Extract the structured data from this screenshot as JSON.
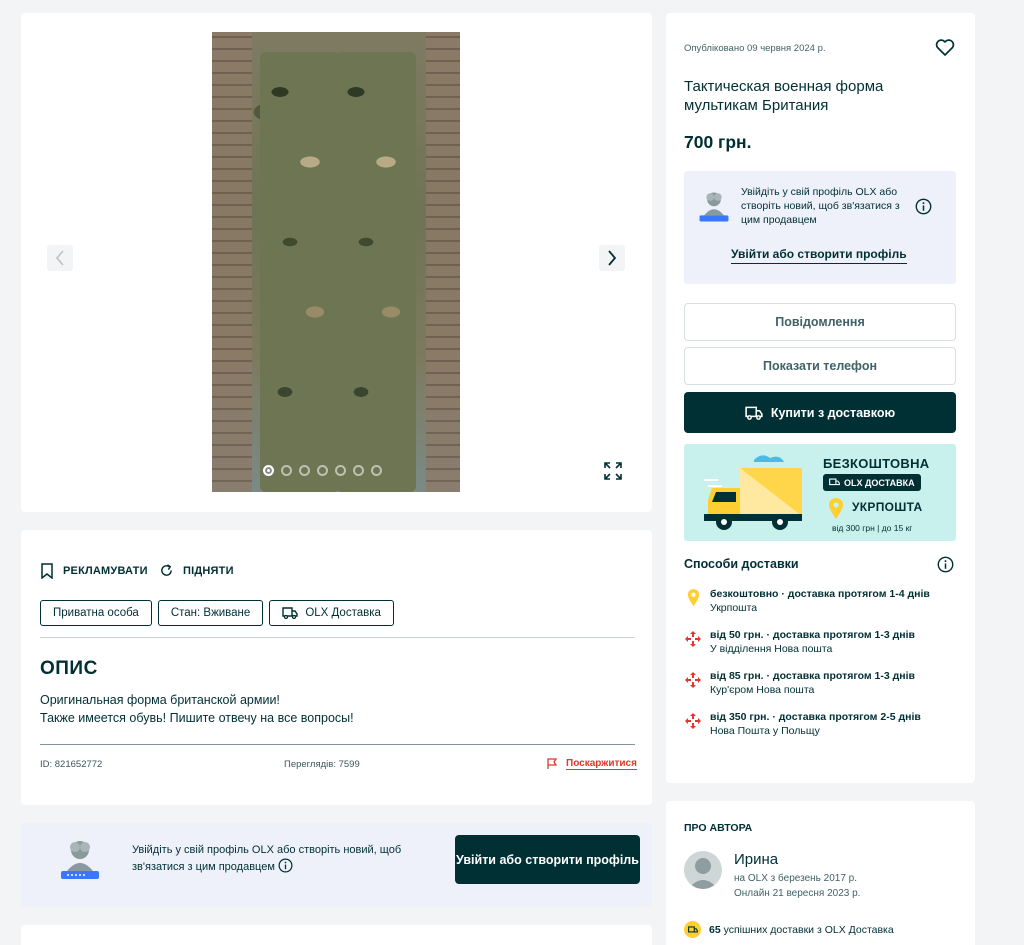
{
  "gallery": {
    "slide_count": 7,
    "active_slide": 1
  },
  "details": {
    "promote_label": "РЕКЛАМУВАТИ",
    "raise_label": "ПІДНЯТИ",
    "tags": [
      "Приватна особа",
      "Стан: Вживане",
      "OLX Доставка"
    ],
    "description_heading": "ОПИС",
    "description_lines": [
      "Оригинальная форма британской армии!",
      "Также имеется обувь! Пишите отвечу на все вопросы!"
    ],
    "id_text": "ID: 821652772",
    "views_text": "Переглядів: 7599",
    "report_label": "Поскаржитися"
  },
  "login_banner": {
    "message": "Увійдіть у свій профіль OLX або створіть новий, щоб зв'язатися з цим продавцем",
    "button_label": "Увійти або створити профіль"
  },
  "offer": {
    "published": "Опубліковано 09 червня 2024 р.",
    "title": "Тактическая военная форма мультикам Британия",
    "price": "700 грн.",
    "login_message": "Увійдіть у свій профіль OLX або створіть новий, щоб зв'язатися з цим продавцем",
    "login_link": "Увійти або створити профіль",
    "message_button": "Повідомлення",
    "phone_button": "Показати телефон",
    "buy_button": "Купити з доставкою"
  },
  "promo": {
    "free": "БЕЗКОШТОВНА",
    "olx_delivery": "OLX ДОСТАВКА",
    "ukrposhta": "УКРПОШТА",
    "conditions": "від 300 грн | до 15 кг"
  },
  "delivery": {
    "heading": "Способи доставки",
    "options": [
      {
        "price_line": "безкоштовно · доставка протягом 1-4 днів",
        "carrier": "Укрпошта",
        "icon": "ukrposhta-pin-icon"
      },
      {
        "price_line": "від 50 грн. · доставка протягом 1-3 днів",
        "carrier": "У відділення Нова пошта",
        "icon": "nova-poshta-icon"
      },
      {
        "price_line": "від 85 грн. · доставка протягом 1-3 днів",
        "carrier": "Кур'єром Нова пошта",
        "icon": "nova-poshta-icon"
      },
      {
        "price_line": "від 350 грн. · доставка протягом 2-5 днів",
        "carrier": "Нова Пошта у Польщу",
        "icon": "nova-poshta-icon"
      }
    ]
  },
  "author": {
    "heading": "ПРО АВТОРА",
    "name": "Ирина",
    "since": "на OLX з березень 2017 р.",
    "online": "Онлайн 21 вересня 2023 р.",
    "deliveries_count": "65",
    "deliveries_text": "успішних доставки з OLX Доставка"
  },
  "colors": {
    "brand_dark": "#002f34",
    "page_bg": "#f2f4f5",
    "login_bg": "#eef1fa",
    "promo_bg": "#c8f0ec",
    "report_red": "#e4352f",
    "ukrposhta_yellow": "#ffce32"
  }
}
